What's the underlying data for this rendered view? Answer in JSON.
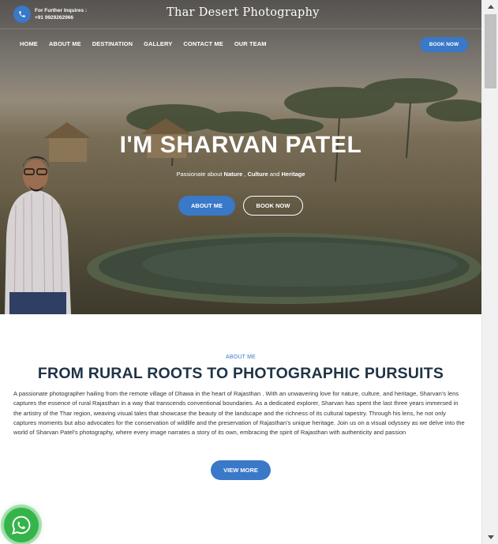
{
  "topbar": {
    "inquiry_label": "For Further Inquires :",
    "phone": "+91 9929262966",
    "brand": "Thar Desert Photography"
  },
  "nav": {
    "items": [
      {
        "label": "HOME"
      },
      {
        "label": "ABOUT ME"
      },
      {
        "label": "DESTINATION"
      },
      {
        "label": "GALLERY"
      },
      {
        "label": "CONTACT ME"
      },
      {
        "label": "OUR TEAM"
      }
    ],
    "book_now": "BOOK NOW"
  },
  "hero": {
    "title": "I'M SHARVAN PATEL",
    "subtitle_prefix": "Passionate about ",
    "subtitle_nature": "Nature",
    "subtitle_sep": " , ",
    "subtitle_culture": "Culture",
    "subtitle_and": " and ",
    "subtitle_heritage": "Heritage",
    "about_button": "ABOUT ME",
    "book_button": "BOOK NOW"
  },
  "about": {
    "kicker": "ABOUT ME",
    "title": "FROM RURAL ROOTS TO PHOTOGRAPHIC PURSUITS",
    "text": "A passionate photographer hailing from the remote village of Dhawa in the heart of Rajasthan . With an unwavering love for nature, culture, and heritage, Sharvan's lens captures the essence of rural Rajasthan in a way that transcends conventional boundaries. As a dedicated explorer, Sharvan has spent the last three years immersed in the artistry of the Thar region, weaving visual tales that showcase the beauty of the landscape and the richness of its cultural tapestry. Through his lens, he not only captures moments but also advocates for the conservation of wildlife and the preservation of Rajasthan's unique heritage. Join us on a visual odyssey as we delve into the world of Sharvan Patel's photography, where every image narrates a story of its own, embracing the spirit of Rajasthan with authenticity and passion",
    "view_more": "VIEW MORE"
  },
  "icons": {
    "phone": "phone-icon",
    "whatsapp": "whatsapp-icon",
    "scroll_up": "scroll-up-arrow-icon",
    "scroll_down": "scroll-down-arrow-icon"
  },
  "colors": {
    "accent": "#3a78c8",
    "heading": "#1f3346",
    "whatsapp": "#35b44a"
  }
}
